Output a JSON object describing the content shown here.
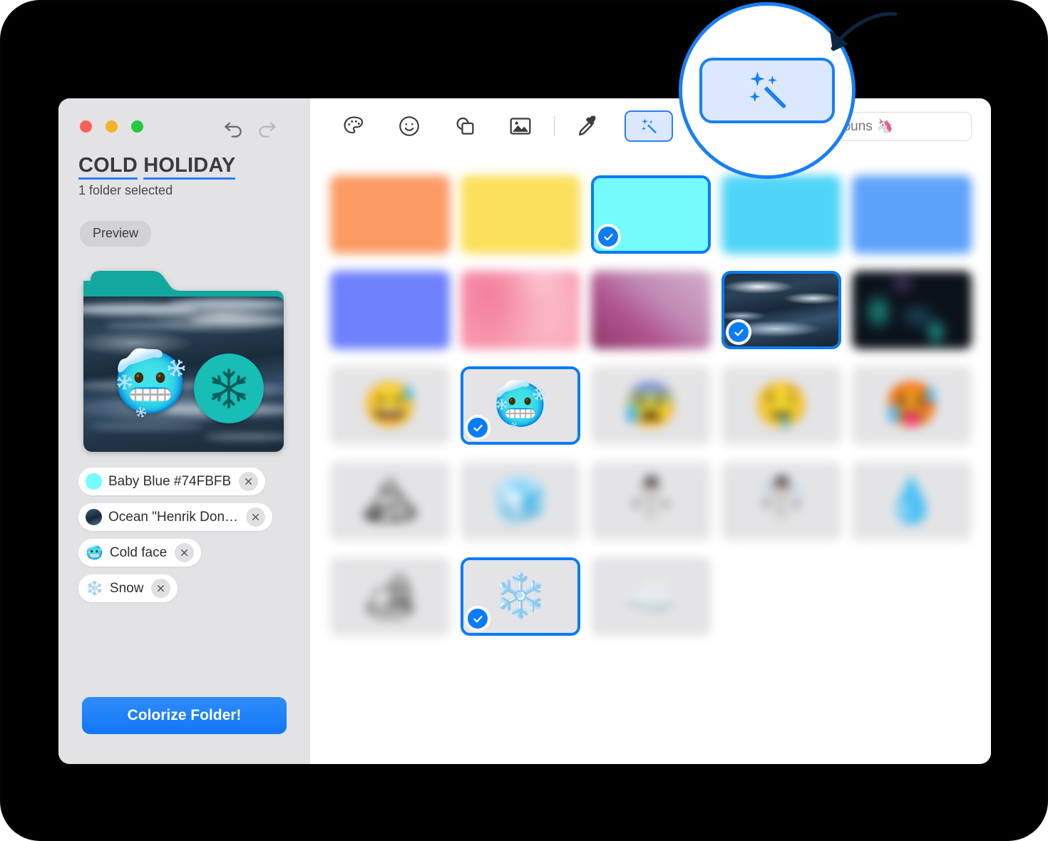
{
  "window": {
    "traffic_lights": [
      {
        "name": "close",
        "color": "#ff5f57"
      },
      {
        "name": "minimize",
        "color": "#f0b429"
      },
      {
        "name": "zoom",
        "color": "#28c840"
      }
    ]
  },
  "sidebar": {
    "undo_label": "Undo",
    "redo_label": "Redo",
    "title_words": [
      "COLD",
      "HOLIDAY"
    ],
    "subtitle": "1 folder selected",
    "preview_chip": "Preview",
    "preview": {
      "folder_color": "#12a8a0",
      "emoji": "🥶",
      "badge_icon": "snowflake-icon",
      "badge_color": "#18bdb5"
    },
    "tags": [
      {
        "type": "color",
        "swatch": "#74FBFB",
        "label": "Baby Blue #74FBFB",
        "remove": "×"
      },
      {
        "type": "image",
        "swatch": "#2c4a62",
        "label": "Ocean \"Henrik Don…",
        "remove": "×"
      },
      {
        "type": "emoji",
        "emoji": "🥶",
        "label": "Cold face",
        "remove": "×"
      },
      {
        "type": "emoji",
        "emoji": "❄️",
        "label": "Snow",
        "remove": "×"
      }
    ],
    "colorize_button": "Colorize Folder!"
  },
  "toolbar": {
    "items": [
      {
        "icon": "palette-icon",
        "label": "Colors"
      },
      {
        "icon": "smiley-icon",
        "label": "Emoji"
      },
      {
        "icon": "shapes-icon",
        "label": "Symbols"
      },
      {
        "icon": "image-icon",
        "label": "Images"
      },
      {
        "icon": "divider",
        "label": ""
      },
      {
        "icon": "eyedropper-icon",
        "label": "Eyedropper"
      },
      {
        "icon": "magic-wand-icon",
        "label": "Magic"
      }
    ],
    "search": {
      "value": "",
      "placeholder": "Try nouns 🦄",
      "visible_text": "y nouns 🦄"
    }
  },
  "callout": {
    "highlight_icon": "magic-wand-icon",
    "border_color": "#1a7ff5",
    "fill_color": "#dbe8fe",
    "arrow": "arrow-icon"
  },
  "grid": {
    "rows": [
      {
        "kind": "color",
        "cells": [
          {
            "name": "swatch-orange",
            "color": "#fb9a63",
            "selected": false,
            "blurred": true
          },
          {
            "name": "swatch-yellow",
            "color": "#fbe05c",
            "selected": false,
            "blurred": true
          },
          {
            "name": "swatch-baby-blue",
            "color": "#74FBFB",
            "selected": true,
            "blurred": false
          },
          {
            "name": "swatch-sky",
            "color": "#4fd4f7",
            "selected": false,
            "blurred": true
          },
          {
            "name": "swatch-blue",
            "color": "#5ea3fb",
            "selected": false,
            "blurred": true
          }
        ]
      },
      {
        "kind": "image",
        "cells": [
          {
            "name": "swatch-periwinkle",
            "color": "#6e80fb",
            "selected": false,
            "blurred": true
          },
          {
            "name": "image-pink-wash",
            "color": "#f79ab0",
            "selected": false,
            "blurred": true
          },
          {
            "name": "image-magenta-wash",
            "color": "#b9548a",
            "selected": false,
            "blurred": true
          },
          {
            "name": "image-ocean",
            "color": "#2c4a62",
            "selected": true,
            "blurred": false
          },
          {
            "name": "image-aurora",
            "color": "#0d1420",
            "selected": false,
            "blurred": true
          }
        ]
      },
      {
        "kind": "emoji",
        "cells": [
          {
            "name": "emoji-sweat-smile",
            "emoji": "😅",
            "selected": false,
            "blurred": true
          },
          {
            "name": "emoji-cold-face",
            "emoji": "🥶",
            "selected": true,
            "blurred": false
          },
          {
            "name": "emoji-cold-sweat",
            "emoji": "😰",
            "selected": false,
            "blurred": true
          },
          {
            "name": "emoji-drooling",
            "emoji": "🤤",
            "selected": false,
            "blurred": true
          },
          {
            "name": "emoji-hot-face",
            "emoji": "🥵",
            "selected": false,
            "blurred": true
          }
        ]
      },
      {
        "kind": "emoji",
        "cells": [
          {
            "name": "emoji-snow-mountain",
            "emoji": "🏔",
            "selected": false,
            "blurred": true
          },
          {
            "name": "emoji-ice",
            "emoji": "🧊",
            "selected": false,
            "blurred": true
          },
          {
            "name": "emoji-snowman",
            "emoji": "⛄",
            "selected": false,
            "blurred": true
          },
          {
            "name": "emoji-snowman-snow",
            "emoji": "☃️",
            "selected": false,
            "blurred": true
          },
          {
            "name": "emoji-droplet",
            "emoji": "💧",
            "selected": false,
            "blurred": true
          }
        ]
      },
      {
        "kind": "emoji",
        "cells": [
          {
            "name": "emoji-camping",
            "emoji": "🏕",
            "selected": false,
            "blurred": true
          },
          {
            "name": "emoji-snowflake",
            "emoji": "❄️",
            "selected": true,
            "blurred": false
          },
          {
            "name": "emoji-cloud",
            "emoji": "☁️",
            "selected": false,
            "blurred": true
          }
        ]
      }
    ]
  },
  "colors": {
    "accent": "#0a7cf7",
    "sidebar_bg": "#e3e3e5",
    "tile_bg": "#e4e4e6",
    "bezel": "#000000"
  }
}
